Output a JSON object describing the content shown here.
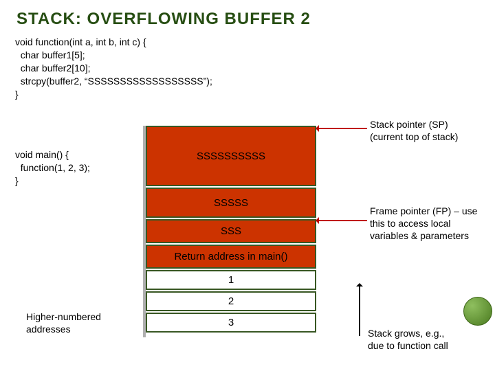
{
  "title": "STACK: OVERFLOWING BUFFER 2",
  "code1": "void function(int a, int b, int c) {\n  char buffer1[5];\n  char buffer2[10];\n  strcpy(buffer2, “SSSSSSSSSSSSSSSSSS”);\n}",
  "code2": "void main() {\n  function(1, 2, 3);\n}",
  "stack": {
    "cells": [
      {
        "text": "SSSSSSSSSS"
      },
      {
        "text": "SSSSS"
      },
      {
        "text": "SSS"
      },
      {
        "text": "Return address in main()"
      },
      {
        "text": "1"
      },
      {
        "text": "2"
      },
      {
        "text": "3"
      }
    ]
  },
  "labels": {
    "sp": "Stack pointer (SP)\n(current top of stack)",
    "fp": "Frame pointer (FP) – use this to access local variables & parameters",
    "grow": "Stack grows, e.g.,\ndue to function call",
    "high": "Higher-numbered\naddresses"
  }
}
